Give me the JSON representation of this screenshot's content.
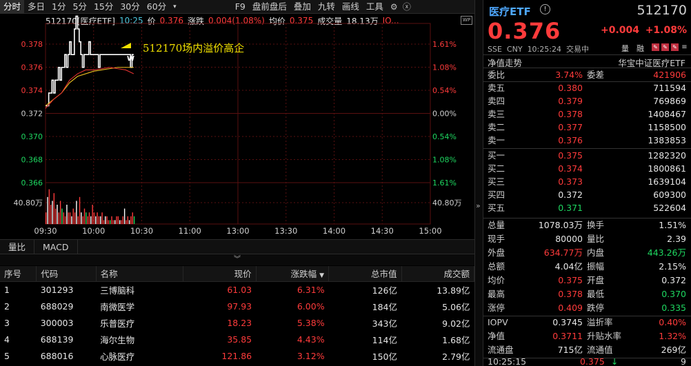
{
  "toolbar": {
    "items": [
      "分时",
      "多日",
      "1分",
      "5分",
      "15分",
      "30分",
      "60分",
      "F9",
      "盘前盘后",
      "叠加",
      "九转",
      "画线",
      "工具"
    ],
    "dropdown_glyph": "▾",
    "gear_icon": "gear-icon",
    "close_icon": "close-icon"
  },
  "chart_header": {
    "code_name": "512170[医疗ETF]",
    "time": "10:25",
    "price_label": "价",
    "price": "0.376",
    "change_label": "涨跌",
    "change": "0.004(1.08%)",
    "avg_label": "均价",
    "avg": "0.375",
    "volume_label": "成交量",
    "volume": "18.13万",
    "iopv_label": "IO..."
  },
  "annotation": "512170场内溢价高企",
  "badge": "W",
  "corner_icon": "WP",
  "chart_data": {
    "type": "line",
    "y_left_ticks": [
      "0.378",
      "0.376",
      "0.374",
      "0.372",
      "0.370",
      "0.368",
      "0.366"
    ],
    "y_right_ticks": [
      "1.61%",
      "1.08%",
      "0.54%",
      "0.00%",
      "0.54%",
      "1.08%",
      "1.61%"
    ],
    "volume_label_left": "40.80万",
    "volume_label_right": "40.80万",
    "x_ticks": [
      "09:30",
      "10:00",
      "10:30",
      "11:00",
      "13:00",
      "13:30",
      "14:00",
      "14:30",
      "15:00"
    ],
    "ylim": [
      0.366,
      0.378
    ],
    "prev_close": 0.372,
    "series": [
      {
        "name": "价",
        "color": "#ffffff",
        "x": [
          0,
          1,
          2,
          3,
          4,
          5,
          6,
          7,
          8,
          9,
          10,
          11,
          12,
          13,
          14,
          15,
          16,
          17,
          18,
          19,
          20,
          21,
          22,
          23,
          24,
          25,
          26,
          27,
          28,
          29,
          30,
          31,
          32,
          33,
          34,
          35,
          36,
          37,
          38,
          39,
          40,
          41,
          42,
          43,
          44,
          45,
          46,
          47,
          48,
          49,
          50,
          51,
          52,
          53,
          54,
          55
        ],
        "y": [
          0.372,
          0.372,
          0.373,
          0.373,
          0.374,
          0.373,
          0.374,
          0.374,
          0.375,
          0.374,
          0.375,
          0.375,
          0.376,
          0.375,
          0.376,
          0.377,
          0.376,
          0.376,
          0.378,
          0.379,
          0.378,
          0.377,
          0.376,
          0.375,
          0.376,
          0.376,
          0.376,
          0.377,
          0.376,
          0.376,
          0.376,
          0.376,
          0.376,
          0.375,
          0.376,
          0.376,
          0.376,
          0.376,
          0.376,
          0.376,
          0.376,
          0.376,
          0.376,
          0.376,
          0.376,
          0.376,
          0.376,
          0.376,
          0.376,
          0.376,
          0.376,
          0.376,
          0.376,
          0.375,
          0.376,
          0.376
        ]
      },
      {
        "name": "均价",
        "color": "#f0c020",
        "x": [
          0,
          5,
          10,
          15,
          20,
          25,
          30,
          35,
          40,
          45,
          50,
          55
        ],
        "y": [
          0.372,
          0.3725,
          0.373,
          0.3738,
          0.3743,
          0.3745,
          0.3747,
          0.3748,
          0.3749,
          0.375,
          0.375,
          0.375
        ]
      },
      {
        "name": "IOPV",
        "color": "#e03030",
        "x": [
          0,
          5,
          10,
          15,
          20,
          25,
          30,
          35,
          40,
          45,
          50,
          55
        ],
        "y": [
          0.3718,
          0.3725,
          0.373,
          0.374,
          0.3745,
          0.3748,
          0.3748,
          0.3749,
          0.375,
          0.3749,
          0.3748,
          0.3745
        ]
      }
    ],
    "volumes": [
      0.3,
      0.7,
      0.9,
      0.5,
      0.6,
      0.8,
      0.4,
      0.5,
      0.3,
      0.6,
      0.4,
      0.3,
      0.2,
      0.5,
      0.3,
      0.3,
      0.2,
      0.4,
      0.3,
      0.6,
      0.2,
      0.7,
      0.3,
      0.2,
      0.4,
      0.3,
      0.2,
      0.3,
      0.2,
      0.5,
      0.3,
      0.2,
      0.3,
      0.2,
      0.2,
      0.3,
      0.1,
      0.2,
      0.2,
      0.1,
      0.1,
      0.2,
      0.1,
      0.1,
      0.2,
      0.2,
      0.1,
      0.1,
      0.2,
      0.4,
      0.1,
      0.2,
      0.1,
      0.2,
      0.3,
      0.2
    ]
  },
  "panel_tabs": [
    "量比",
    "MACD"
  ],
  "table": {
    "headers": [
      "序号",
      "代码",
      "名称",
      "现价",
      "涨跌幅",
      "总市值",
      "成交额"
    ],
    "sort_glyph": "▼",
    "rows": [
      [
        "1",
        "301293",
        "三博脑科",
        "61.03",
        "6.31%",
        "126亿",
        "13.89亿"
      ],
      [
        "2",
        "688029",
        "南微医学",
        "97.93",
        "6.00%",
        "184亿",
        "5.06亿"
      ],
      [
        "3",
        "300003",
        "乐普医疗",
        "18.23",
        "5.38%",
        "343亿",
        "9.02亿"
      ],
      [
        "4",
        "688139",
        "海尔生物",
        "35.85",
        "4.43%",
        "114亿",
        "1.68亿"
      ],
      [
        "5",
        "688016",
        "心脉医疗",
        "121.86",
        "3.12%",
        "150亿",
        "2.79亿"
      ]
    ]
  },
  "quote": {
    "name": "医疗ETF",
    "code": "512170",
    "price": "0.376",
    "change": "+0.004",
    "change_pct": "+1.08%",
    "exchange": "SSE",
    "currency": "CNY",
    "time": "10:25:24",
    "status": "交易中",
    "flags": [
      "量",
      "融"
    ],
    "nav_title": "净值走势",
    "index_name": "华宝中证医疗ETF",
    "weibi_label": "委比",
    "weibi": "3.74%",
    "weicha_label": "委差",
    "weicha": "421906",
    "asks": [
      {
        "label": "卖五",
        "price": "0.380",
        "vol": "711594"
      },
      {
        "label": "卖四",
        "price": "0.379",
        "vol": "769869"
      },
      {
        "label": "卖三",
        "price": "0.378",
        "vol": "1408467"
      },
      {
        "label": "卖二",
        "price": "0.377",
        "vol": "1158500"
      },
      {
        "label": "卖一",
        "price": "0.376",
        "vol": "1383853"
      }
    ],
    "bids": [
      {
        "label": "买一",
        "price": "0.375",
        "vol": "1282320"
      },
      {
        "label": "买二",
        "price": "0.374",
        "vol": "1800861"
      },
      {
        "label": "买三",
        "price": "0.373",
        "vol": "1639104"
      },
      {
        "label": "买四",
        "price": "0.372",
        "vol": "609300"
      },
      {
        "label": "买五",
        "price": "0.371",
        "vol": "522604"
      }
    ],
    "stats": [
      {
        "l1": "总量",
        "v1": "1078.03万",
        "c1": "white",
        "l2": "换手",
        "v2": "1.51%",
        "c2": "white"
      },
      {
        "l1": "现手",
        "v1": "80000",
        "c1": "white",
        "l2": "量比",
        "v2": "2.39",
        "c2": "white"
      },
      {
        "l1": "外盘",
        "v1": "634.77万",
        "c1": "red",
        "l2": "内盘",
        "v2": "443.26万",
        "c2": "green"
      },
      {
        "l1": "总额",
        "v1": "4.04亿",
        "c1": "white",
        "l2": "振幅",
        "v2": "2.15%",
        "c2": "white"
      },
      {
        "l1": "均价",
        "v1": "0.375",
        "c1": "red",
        "l2": "开盘",
        "v2": "0.372",
        "c2": "white"
      },
      {
        "l1": "最高",
        "v1": "0.378",
        "c1": "red",
        "l2": "最低",
        "v2": "0.370",
        "c2": "green"
      },
      {
        "l1": "涨停",
        "v1": "0.409",
        "c1": "red",
        "l2": "跌停",
        "v2": "0.335",
        "c2": "green"
      }
    ],
    "stats2": [
      {
        "l1": "IOPV",
        "v1": "0.3745",
        "c1": "white",
        "l2": "溢折率",
        "v2": "0.40%",
        "c2": "red"
      },
      {
        "l1": "净值",
        "v1": "0.3711",
        "c1": "red",
        "l2": "升贴水率",
        "v2": "1.32%",
        "c2": "red"
      },
      {
        "l1": "流通盘",
        "v1": "715亿",
        "c1": "white",
        "l2": "流通值",
        "v2": "269亿",
        "c2": "white"
      }
    ],
    "last_time": "10:25:15",
    "last_price": "0.375",
    "last_vol": "9"
  }
}
